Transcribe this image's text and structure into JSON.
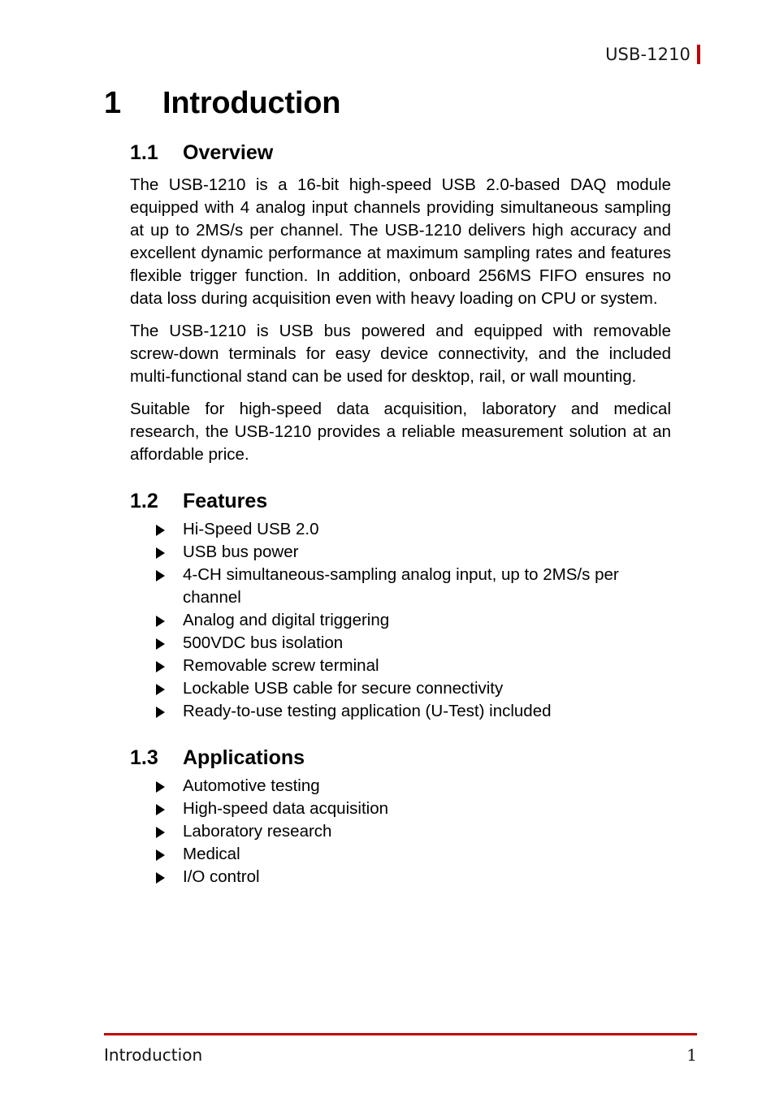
{
  "colors": {
    "accent_red": "#C00000",
    "text": "#000000"
  },
  "header": {
    "document_title": "USB-1210"
  },
  "chapter": {
    "number": "1",
    "title": "Introduction"
  },
  "sections": [
    {
      "number": "1.1",
      "title": "Overview",
      "paragraphs": [
        "The USB-1210 is a 16-bit high-speed USB 2.0-based DAQ module equipped with 4 analog input channels providing simultaneous sampling at up to 2MS/s per channel. The USB-1210 delivers high accuracy and excellent dynamic performance at maximum sampling rates and features flexible trigger function. In addition, onboard 256MS FIFO ensures no data loss during acquisition even with heavy loading on CPU or system.",
        "The USB-1210 is USB bus powered and equipped with removable screw-down terminals for easy device connectivity, and the included multi-functional stand can be used for desktop, rail, or wall mounting.",
        "Suitable for high-speed data acquisition, laboratory and medical research, the USB-1210 provides a reliable measurement solution at an affordable price."
      ]
    },
    {
      "number": "1.2",
      "title": "Features",
      "bullets": [
        "Hi-Speed USB 2.0",
        "USB bus power",
        "4-CH simultaneous-sampling analog input, up to 2MS/s per channel",
        "Analog and digital triggering",
        "500VDC bus isolation",
        "Removable screw terminal",
        "Lockable USB cable for secure connectivity",
        "Ready-to-use testing application (U-Test) included"
      ]
    },
    {
      "number": "1.3",
      "title": "Applications",
      "bullets": [
        "Automotive testing",
        "High-speed data acquisition",
        "Laboratory research",
        "Medical",
        "I/O control"
      ]
    }
  ],
  "footer": {
    "left_text": "Introduction",
    "page_number": "1"
  }
}
